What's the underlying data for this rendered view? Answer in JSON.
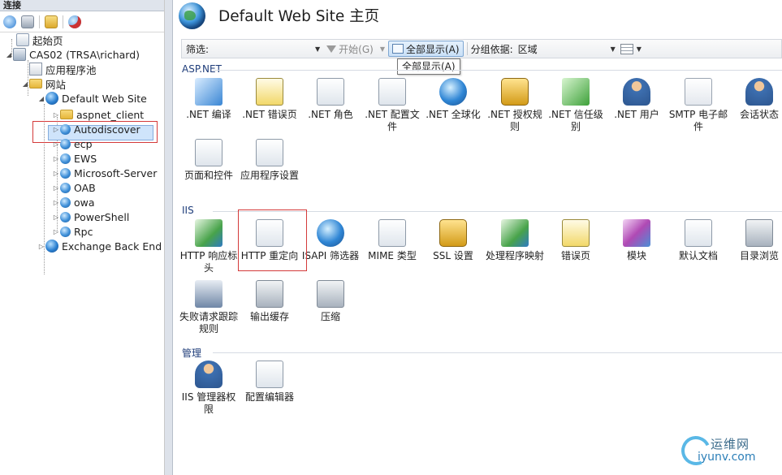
{
  "left_pane": {
    "header": "连接",
    "toolbar_icons": [
      "connect-icon",
      "save-icon",
      "up-folder-icon",
      "disconnect-icon"
    ],
    "tree": [
      {
        "label": "起始页",
        "icon": "start-page-icon",
        "name": "tree-start-page"
      },
      {
        "label": "CAS02 (TRSA\\richard)",
        "icon": "server-icon",
        "name": "tree-server"
      },
      {
        "label": "应用程序池",
        "icon": "app-pool-icon",
        "name": "tree-app-pools"
      },
      {
        "label": "网站",
        "icon": "sites-folder-icon",
        "name": "tree-sites"
      },
      {
        "label": "Default Web Site",
        "icon": "globe-icon",
        "name": "tree-default-web-site"
      },
      {
        "label": "aspnet_client",
        "icon": "folder-icon",
        "name": "tree-aspnet-client"
      },
      {
        "label": "Autodiscover",
        "icon": "app-globe-icon",
        "name": "tree-autodiscover"
      },
      {
        "label": "ecp",
        "icon": "app-globe-icon",
        "name": "tree-ecp"
      },
      {
        "label": "EWS",
        "icon": "app-globe-icon",
        "name": "tree-ews"
      },
      {
        "label": "Microsoft-Server",
        "icon": "app-globe-icon",
        "name": "tree-microsoft-server"
      },
      {
        "label": "OAB",
        "icon": "app-globe-icon",
        "name": "tree-oab"
      },
      {
        "label": "owa",
        "icon": "app-globe-icon",
        "name": "tree-owa"
      },
      {
        "label": "PowerShell",
        "icon": "app-globe-icon",
        "name": "tree-powershell"
      },
      {
        "label": "Rpc",
        "icon": "app-globe-icon",
        "name": "tree-rpc"
      },
      {
        "label": "Exchange Back End",
        "icon": "globe-icon",
        "name": "tree-exchange-back-end"
      }
    ]
  },
  "main": {
    "title": "Default Web Site 主页",
    "filter": {
      "label": "筛选:",
      "value": "",
      "start_label": "开始(G)",
      "show_all_label": "全部显示(A)",
      "group_by_label": "分组依据:",
      "group_by_value": "区域",
      "tooltip": "全部显示(A)"
    },
    "sections": [
      {
        "title": "ASP.NET",
        "features": [
          {
            "label": ".NET 编译",
            "icon": "net-compilation-icon"
          },
          {
            "label": ".NET 错误页",
            "icon": "net-error-pages-icon"
          },
          {
            "label": ".NET 角色",
            "icon": "net-roles-icon"
          },
          {
            "label": ".NET 配置文件",
            "icon": "net-profile-icon"
          },
          {
            "label": ".NET 全球化",
            "icon": "net-globalization-icon"
          },
          {
            "label": ".NET 授权规则",
            "icon": "net-authorization-icon"
          },
          {
            "label": ".NET 信任级别",
            "icon": "net-trust-levels-icon"
          },
          {
            "label": ".NET 用户",
            "icon": "net-users-icon"
          },
          {
            "label": "SMTP 电子邮件",
            "icon": "smtp-email-icon"
          },
          {
            "label": "会话状态",
            "icon": "session-state-icon"
          },
          {
            "label": "页面和控件",
            "icon": "pages-controls-icon"
          },
          {
            "label": "应用程序设置",
            "icon": "app-settings-icon"
          }
        ]
      },
      {
        "title": "IIS",
        "features": [
          {
            "label": "HTTP 响应标头",
            "icon": "http-response-headers-icon"
          },
          {
            "label": "HTTP 重定向",
            "icon": "http-redirect-icon"
          },
          {
            "label": "ISAPI 筛选器",
            "icon": "isapi-filters-icon"
          },
          {
            "label": "MIME 类型",
            "icon": "mime-types-icon"
          },
          {
            "label": "SSL 设置",
            "icon": "ssl-settings-icon"
          },
          {
            "label": "处理程序映射",
            "icon": "handler-mappings-icon"
          },
          {
            "label": "错误页",
            "icon": "error-pages-icon"
          },
          {
            "label": "模块",
            "icon": "modules-icon"
          },
          {
            "label": "默认文档",
            "icon": "default-document-icon"
          },
          {
            "label": "目录浏览",
            "icon": "directory-browsing-icon"
          },
          {
            "label": "失败请求跟踪规则",
            "icon": "failed-request-tracing-icon"
          },
          {
            "label": "输出缓存",
            "icon": "output-caching-icon"
          },
          {
            "label": "压缩",
            "icon": "compression-icon"
          }
        ]
      },
      {
        "title": "管理",
        "features": [
          {
            "label": "IIS 管理器权限",
            "icon": "iis-manager-permissions-icon"
          },
          {
            "label": "配置编辑器",
            "icon": "configuration-editor-icon"
          }
        ]
      }
    ]
  },
  "watermark": {
    "line1": "运维网",
    "line2": "iyunv.com"
  }
}
